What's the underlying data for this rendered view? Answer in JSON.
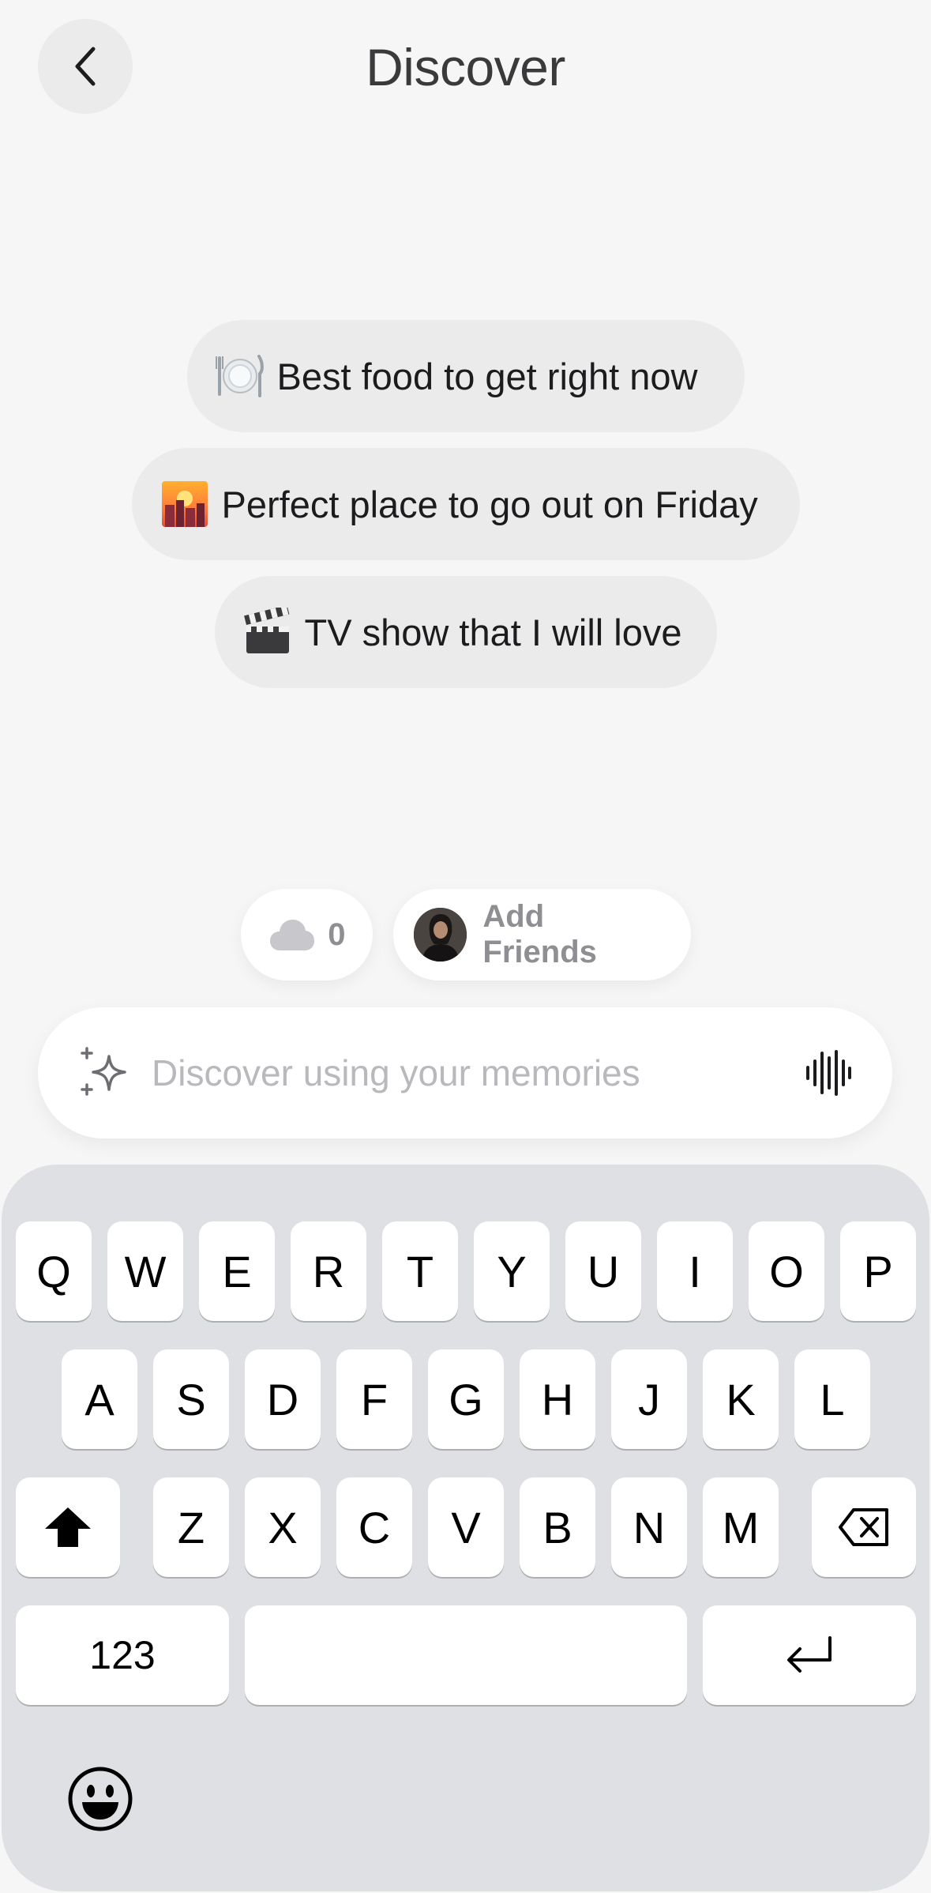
{
  "header": {
    "title": "Discover"
  },
  "suggestions": [
    {
      "label": "Best food to get right now",
      "icon": "plate-icon"
    },
    {
      "label": "Perfect place to go out on Friday",
      "icon": "city-sunset-icon"
    },
    {
      "label": "TV show that I will love",
      "icon": "clapper-icon"
    }
  ],
  "memories_pill": {
    "count": "0",
    "icon": "cloud-icon"
  },
  "friends_pill": {
    "label": "Add Friends"
  },
  "search": {
    "placeholder": "Discover using your memories",
    "value": ""
  },
  "keyboard": {
    "row1": [
      "Q",
      "W",
      "E",
      "R",
      "T",
      "Y",
      "U",
      "I",
      "O",
      "P"
    ],
    "row2": [
      "A",
      "S",
      "D",
      "F",
      "G",
      "H",
      "J",
      "K",
      "L"
    ],
    "row3": [
      "Z",
      "X",
      "C",
      "V",
      "B",
      "N",
      "M"
    ],
    "numbers_label": "123"
  }
}
